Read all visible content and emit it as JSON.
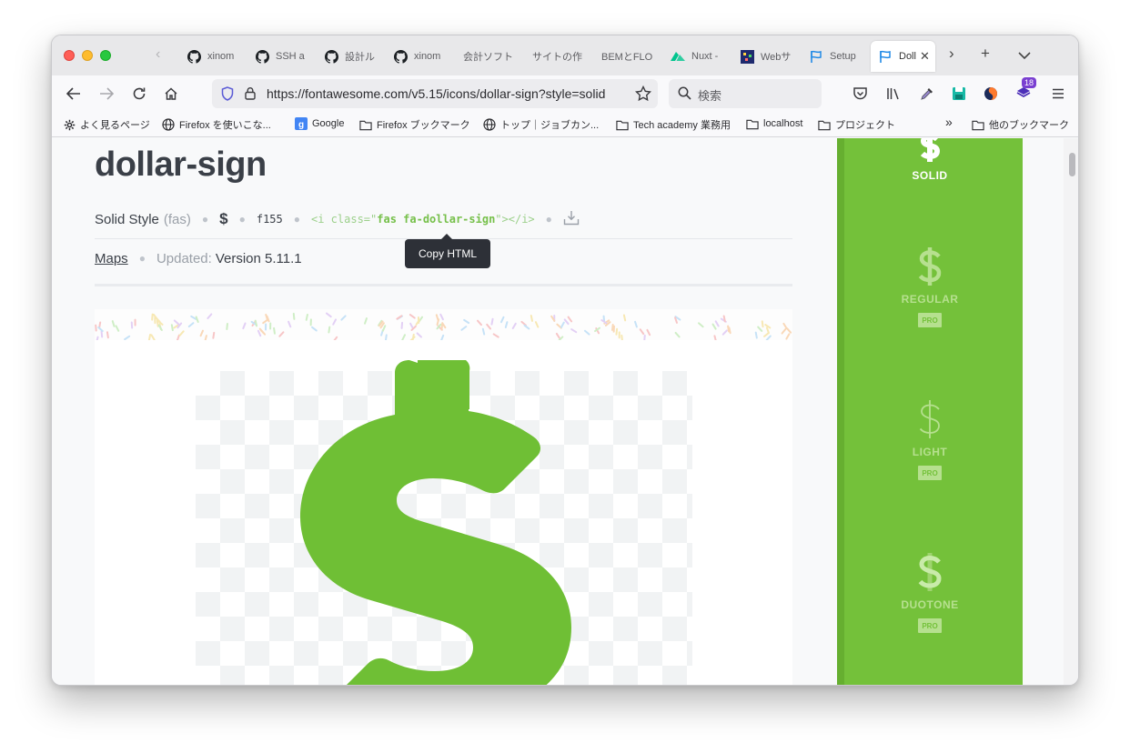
{
  "tabs": [
    {
      "label": "xinom",
      "icon": "github-icon"
    },
    {
      "label": "SSH a",
      "icon": "github-icon"
    },
    {
      "label": "設計ル",
      "icon": "github-icon"
    },
    {
      "label": "xinom",
      "icon": "github-icon"
    },
    {
      "label": "会計ソフト",
      "icon": "none"
    },
    {
      "label": "サイトの作",
      "icon": "none"
    },
    {
      "label": "BEMとFLO",
      "icon": "none"
    },
    {
      "label": "Nuxt -",
      "icon": "nuxt-icon"
    },
    {
      "label": "Webサ",
      "icon": "pixel-icon"
    },
    {
      "label": "Setup",
      "icon": "flag-icon"
    },
    {
      "label": "Doll",
      "icon": "flag-icon",
      "active": true
    }
  ],
  "navbar": {
    "url": "https://fontawesome.com/v5.15/icons/dollar-sign?style=solid",
    "search_placeholder": "検索",
    "extension_badge": "18"
  },
  "bookmarks": [
    {
      "label": "よく見るページ",
      "icon": "gear-icon"
    },
    {
      "label": "Firefox を使いこな...",
      "icon": "globe-icon"
    },
    {
      "label": "Google",
      "icon": "google-icon"
    },
    {
      "label": "Firefox ブックマーク",
      "icon": "folder-icon"
    },
    {
      "label": "トップ｜ジョブカン...",
      "icon": "globe-icon"
    },
    {
      "label": "Tech academy 業務用",
      "icon": "folder-icon"
    },
    {
      "label": "localhost",
      "icon": "folder-icon"
    },
    {
      "label": "プロジェクト",
      "icon": "folder-icon"
    }
  ],
  "bookmarks_other": "他のブックマーク",
  "icon_page": {
    "title": "dollar-sign",
    "style_name": "Solid Style",
    "style_prefix": "(fas)",
    "glyph": "$",
    "unicode": "f155",
    "code_open": "<i class=\"",
    "code_class": "fas fa-dollar-sign",
    "code_close": "\"></i>",
    "tooltip": "Copy HTML",
    "maps_label": "Maps",
    "updated_label": "Updated:",
    "updated_version": "Version 5.11.1"
  },
  "styles": [
    {
      "label": "SOLID",
      "pro": false
    },
    {
      "label": "REGULAR",
      "pro": true
    },
    {
      "label": "LIGHT",
      "pro": true
    },
    {
      "label": "DUOTONE",
      "pro": true
    }
  ],
  "pro_badge": "PRO",
  "colors": {
    "fa_green": "#74c13a",
    "sidebar_text": "#ffffff",
    "pro_text": "#b6e08f"
  }
}
